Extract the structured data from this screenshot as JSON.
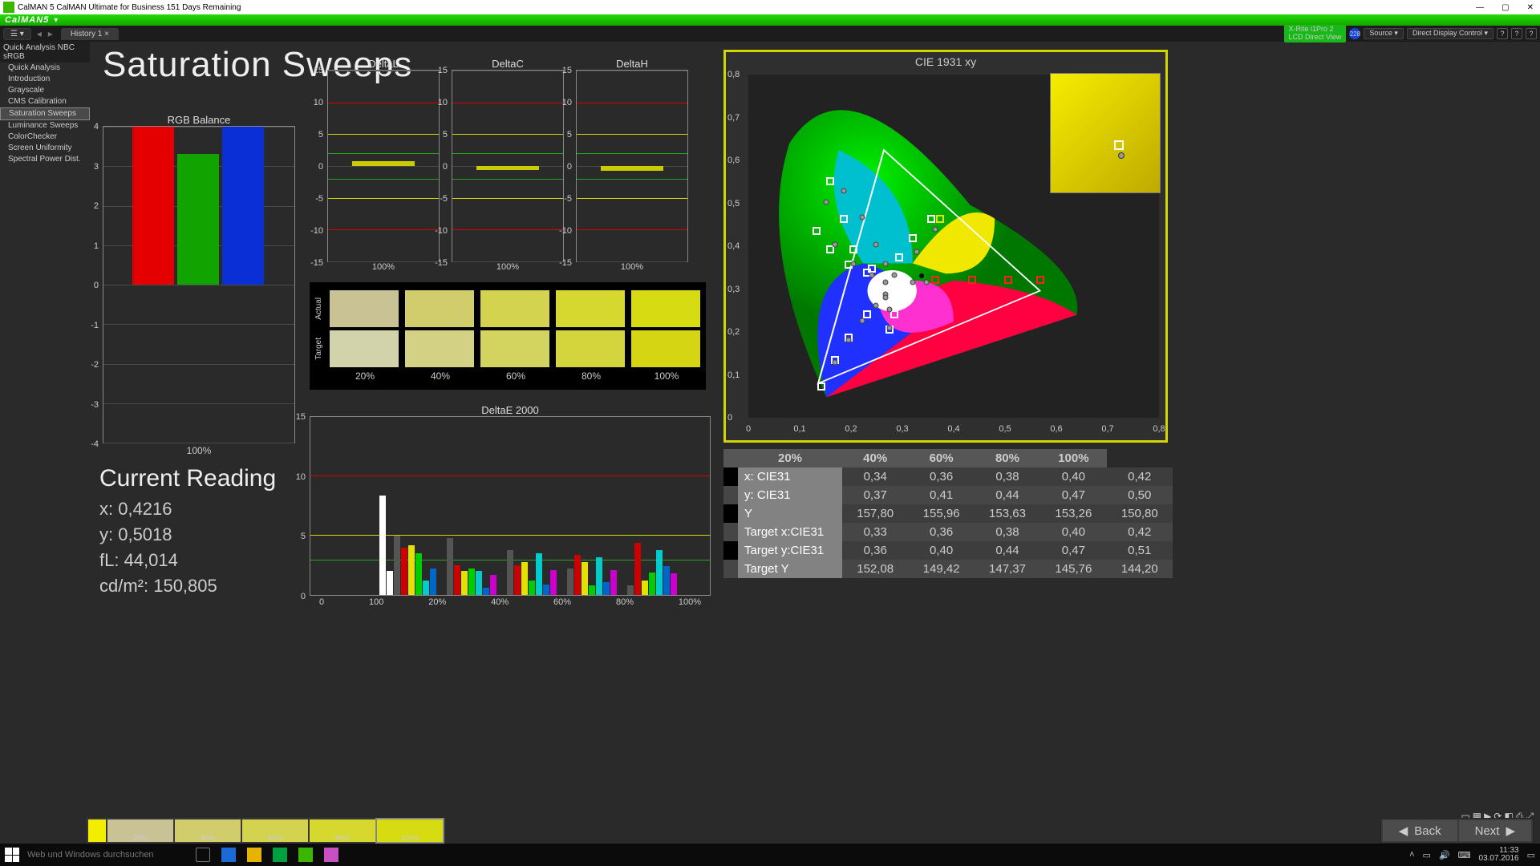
{
  "title_bar": "CalMAN 5 CalMAN Ultimate for Business 151 Days Remaining",
  "app_logo": "CalMAN5",
  "toolbar": {
    "tab": "History 1",
    "device_line1": "X-Rite i1Pro 2",
    "device_line2": "LCD Direct View",
    "badge": "228",
    "source": "Source",
    "ddc": "Direct Display Control"
  },
  "sidebar": {
    "head": "Quick Analysis NBC sRGB",
    "items": [
      "Quick Analysis",
      "Introduction",
      "Grayscale",
      "CMS Calibration",
      "Saturation Sweeps",
      "Luminance Sweeps",
      "ColorChecker",
      "Screen Uniformity",
      "Spectral Power Dist."
    ],
    "selected_index": 4
  },
  "page_title": "Saturation Sweeps",
  "chart_data": [
    {
      "type": "bar",
      "title": "RGB Balance",
      "categories": [
        "100%"
      ],
      "ylim": [
        -4,
        4
      ],
      "series": [
        {
          "name": "Red",
          "values": [
            4
          ],
          "color": "#e40000"
        },
        {
          "name": "Green",
          "values": [
            3.3
          ],
          "color": "#11a400"
        },
        {
          "name": "Blue",
          "values": [
            4
          ],
          "color": "#0b2fd6"
        }
      ]
    },
    {
      "type": "bar",
      "title": "DeltaL",
      "categories": [
        "100%"
      ],
      "ylim": [
        -15,
        15
      ],
      "series": [
        {
          "name": "delta",
          "values": [
            0.7
          ],
          "color": "#d4d400"
        }
      ],
      "ref_lines": {
        "red": [
          10,
          -10
        ],
        "yellow": [
          5,
          -5
        ],
        "green": [
          2,
          -2
        ]
      }
    },
    {
      "type": "bar",
      "title": "DeltaC",
      "categories": [
        "100%"
      ],
      "ylim": [
        -15,
        15
      ],
      "series": [
        {
          "name": "delta",
          "values": [
            -0.6
          ],
          "color": "#d4d400"
        }
      ],
      "ref_lines": {
        "red": [
          10,
          -10
        ],
        "yellow": [
          5,
          -5
        ],
        "green": [
          2,
          -2
        ]
      }
    },
    {
      "type": "bar",
      "title": "DeltaH",
      "categories": [
        "100%"
      ],
      "ylim": [
        -15,
        15
      ],
      "series": [
        {
          "name": "delta",
          "values": [
            -0.8
          ],
          "color": "#d4d400"
        }
      ],
      "ref_lines": {
        "red": [
          10,
          -10
        ],
        "yellow": [
          5,
          -5
        ],
        "green": [
          2,
          -2
        ]
      }
    },
    {
      "type": "bar",
      "title": "DeltaE 2000",
      "categories": [
        "0",
        "100",
        "20%",
        "40%",
        "60%",
        "80%",
        "100%"
      ],
      "ylim": [
        0,
        15
      ],
      "note": "multi-color dE bars per saturation step",
      "series": [
        {
          "name": "20% set",
          "values": [
            8.4,
            2.0,
            5.0,
            4.0,
            4.2,
            3.5,
            1.2,
            2.2
          ],
          "colors": [
            "#fff",
            "#fff",
            "#555",
            "#c00",
            "#e5e000",
            "#0c0",
            "#0cc",
            "#06c"
          ]
        },
        {
          "name": "40% set",
          "values": [
            4.8,
            2.5,
            2.0,
            2.2,
            2.0,
            0.6,
            1.7
          ],
          "colors": [
            "#555",
            "#c00",
            "#e5e000",
            "#0c0",
            "#0cc",
            "#06c",
            "#c0c"
          ]
        },
        {
          "name": "60% set",
          "values": [
            3.8,
            2.5,
            2.8,
            1.2,
            3.5,
            0.9,
            2.1
          ],
          "colors": [
            "#555",
            "#c00",
            "#e5e000",
            "#0c0",
            "#0cc",
            "#06c",
            "#c0c"
          ]
        },
        {
          "name": "80% set",
          "values": [
            2.2,
            3.4,
            2.8,
            0.8,
            3.2,
            1.1,
            2.1
          ],
          "colors": [
            "#555",
            "#c00",
            "#e5e000",
            "#0c0",
            "#0cc",
            "#06c",
            "#c0c"
          ]
        },
        {
          "name": "100% set",
          "values": [
            0.8,
            4.4,
            1.2,
            1.9,
            3.8,
            2.4,
            1.8
          ],
          "colors": [
            "#555",
            "#c00",
            "#e5e000",
            "#0c0",
            "#0cc",
            "#06c",
            "#c0c"
          ]
        }
      ],
      "ref_lines": {
        "red": [
          10
        ],
        "yellow": [
          5
        ],
        "green": [
          3
        ]
      }
    },
    {
      "type": "scatter",
      "title": "CIE 1931 xy",
      "xlim": [
        0,
        0.9
      ],
      "ylim": [
        0,
        0.9
      ],
      "targets_white": [
        [
          0.18,
          0.6
        ],
        [
          0.21,
          0.5
        ],
        [
          0.23,
          0.42
        ],
        [
          0.27,
          0.37
        ],
        [
          0.3,
          0.35
        ],
        [
          0.15,
          0.47
        ],
        [
          0.18,
          0.42
        ],
        [
          0.22,
          0.38
        ],
        [
          0.26,
          0.36
        ],
        [
          0.3,
          0.34
        ],
        [
          0.16,
          0.06
        ],
        [
          0.19,
          0.13
        ],
        [
          0.22,
          0.19
        ],
        [
          0.26,
          0.25
        ],
        [
          0.29,
          0.3
        ],
        [
          0.31,
          0.21
        ],
        [
          0.32,
          0.25
        ],
        [
          0.3,
          0.3
        ],
        [
          0.41,
          0.34
        ],
        [
          0.49,
          0.34
        ],
        [
          0.57,
          0.34
        ],
        [
          0.64,
          0.34
        ],
        [
          0.4,
          0.5
        ],
        [
          0.36,
          0.45
        ],
        [
          0.33,
          0.4
        ]
      ],
      "targets_red": [
        [
          0.41,
          0.34
        ],
        [
          0.49,
          0.34
        ],
        [
          0.57,
          0.34
        ],
        [
          0.64,
          0.34
        ]
      ],
      "targets_yellow": [
        [
          0.42,
          0.5
        ]
      ],
      "measured": [
        [
          0.17,
          0.55
        ],
        [
          0.19,
          0.44
        ],
        [
          0.23,
          0.39
        ],
        [
          0.27,
          0.36
        ],
        [
          0.3,
          0.34
        ],
        [
          0.21,
          0.58
        ],
        [
          0.25,
          0.51
        ],
        [
          0.28,
          0.44
        ],
        [
          0.3,
          0.39
        ],
        [
          0.32,
          0.36
        ],
        [
          0.19,
          0.13
        ],
        [
          0.22,
          0.19
        ],
        [
          0.25,
          0.24
        ],
        [
          0.28,
          0.28
        ],
        [
          0.3,
          0.31
        ],
        [
          0.31,
          0.22
        ],
        [
          0.31,
          0.27
        ],
        [
          0.3,
          0.3
        ],
        [
          0.39,
          0.34
        ],
        [
          0.36,
          0.34
        ],
        [
          0.41,
          0.48
        ],
        [
          0.37,
          0.42
        ]
      ]
    }
  ],
  "swatches": {
    "rows": [
      "Actual",
      "Target"
    ],
    "cols_label": [
      "20%",
      "40%",
      "60%",
      "80%",
      "100%"
    ],
    "actual": [
      "#c9c295",
      "#d1cd6d",
      "#d4d350",
      "#d6d82f",
      "#d7dc12"
    ],
    "target": [
      "#d2d2ab",
      "#d3d284",
      "#d3d35f",
      "#d4d43c",
      "#d5d514"
    ]
  },
  "reading": {
    "title": "Current Reading",
    "x": "x: 0,4216",
    "y": "y: 0,5018",
    "fL": "fL: 44,014",
    "cdm2": "cd/m²: 150,805"
  },
  "data_table": {
    "header": [
      "",
      "20%",
      "40%",
      "60%",
      "80%",
      "100%"
    ],
    "rows": [
      [
        "x: CIE31",
        "0,34",
        "0,36",
        "0,38",
        "0,40",
        "0,42"
      ],
      [
        "y: CIE31",
        "0,37",
        "0,41",
        "0,44",
        "0,47",
        "0,50"
      ],
      [
        "Y",
        "157,80",
        "155,96",
        "153,63",
        "153,26",
        "150,80"
      ],
      [
        "Target x:CIE31",
        "0,33",
        "0,36",
        "0,38",
        "0,40",
        "0,42"
      ],
      [
        "Target y:CIE31",
        "0,36",
        "0,40",
        "0,44",
        "0,47",
        "0,51"
      ],
      [
        "Target Y",
        "152,08",
        "149,42",
        "147,37",
        "145,76",
        "144,20"
      ]
    ]
  },
  "thumbs": {
    "labels": [
      "20%",
      "40%",
      "60%",
      "80%",
      "100%"
    ],
    "colors": [
      "#c9c295",
      "#d1cd6d",
      "#d4d350",
      "#d6d82f",
      "#d7dc12"
    ],
    "selected_index": 4,
    "lead_color": "#f3ed00"
  },
  "nav": {
    "back": "Back",
    "next": "Next"
  },
  "taskbar": {
    "search": "Web und Windows durchsuchen",
    "time": "11:33",
    "date": "03.07.2016"
  }
}
